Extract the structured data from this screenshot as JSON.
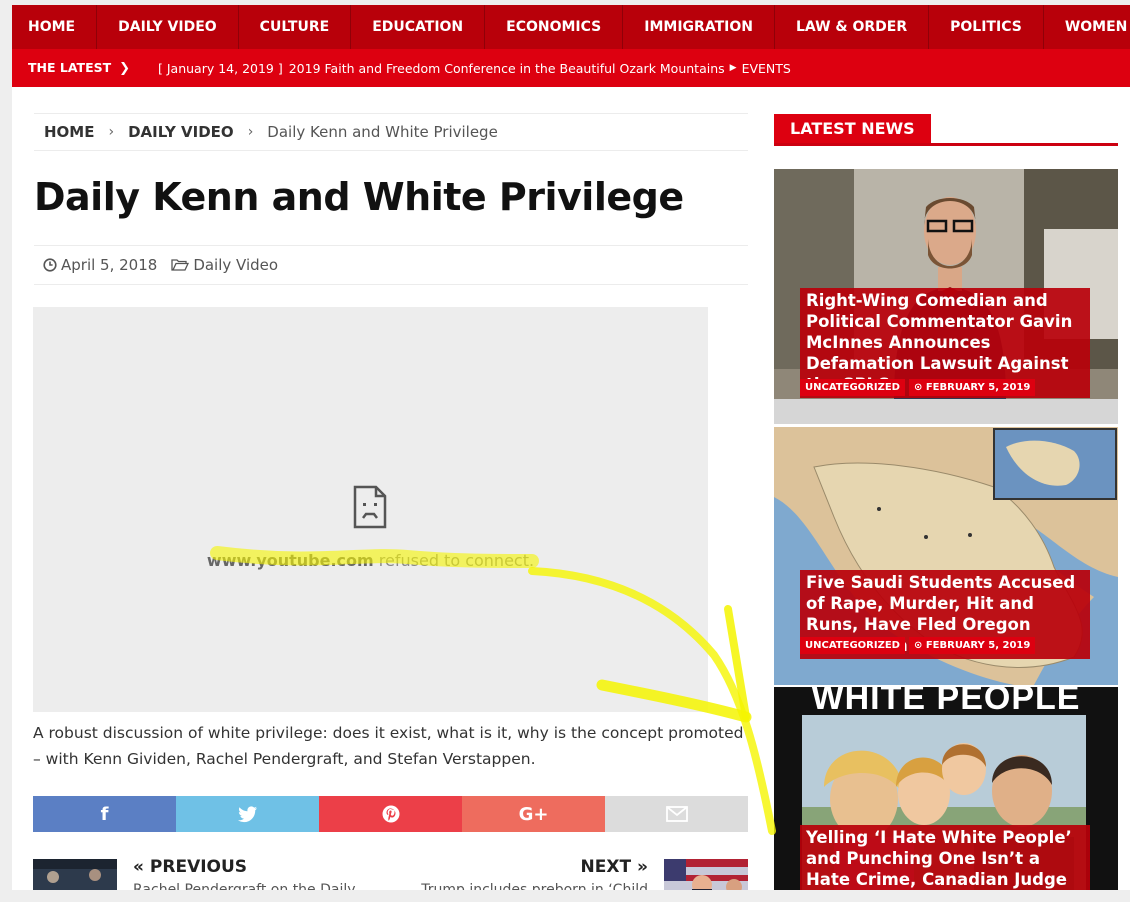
{
  "nav": {
    "items": [
      {
        "label": "HOME"
      },
      {
        "label": "DAILY VIDEO"
      },
      {
        "label": "CULTURE"
      },
      {
        "label": "EDUCATION"
      },
      {
        "label": "ECONOMICS"
      },
      {
        "label": "IMMIGRATION"
      },
      {
        "label": "LAW & ORDER"
      },
      {
        "label": "POLITICS"
      },
      {
        "label": "WOMEN"
      }
    ]
  },
  "ticker": {
    "label": "THE LATEST",
    "date": "[ January 14, 2019 ]",
    "headline": "2019 Faith and Freedom Conference in the Beautiful Ozark Mountains",
    "category": "EVENTS"
  },
  "breadcrumb": {
    "home": "HOME",
    "section": "DAILY VIDEO",
    "current": "Daily Kenn and White Privilege"
  },
  "article": {
    "title": "Daily Kenn and White Privilege",
    "date": "April 5, 2018",
    "category": "Daily Video",
    "embed_domain": "www.youtube.com",
    "embed_message": " refused to connect.",
    "description": "A robust discussion of white privilege: does it exist, what is it, why is the concept promoted – with Kenn Gividen, Rachel Pendergraft, and Stefan Verstappen."
  },
  "share": {
    "facebook": "f",
    "googleplus": "G+"
  },
  "postnav": {
    "prev_label": "« PREVIOUS",
    "prev_text": "Rachel Pendergraft on the Daily",
    "next_label": "NEXT »",
    "next_text": "Trump includes preborn in ‘Child"
  },
  "sidebar": {
    "heading": "LATEST NEWS",
    "cards": [
      {
        "title": "Right-Wing Comedian and Political Commentator Gavin McInnes Announces Defamation Lawsuit Against the SPLC",
        "category": "UNCATEGORIZED",
        "date": "⊙ FEBRUARY 5, 2019"
      },
      {
        "title": "Five Saudi Students Accused of Rape, Murder, Hit and Runs, Have Fled Oregon Before Trial",
        "category": "UNCATEGORIZED",
        "date": "⊙ FEBRUARY 5, 2019"
      },
      {
        "title": "Yelling ‘I Hate White People’ and Punching One Isn’t a Hate Crime, Canadian Judge Rules",
        "image_text": "WHITE PEOPLE"
      }
    ]
  },
  "colors": {
    "brand_red": "#b8000a",
    "ticker_red": "#dd0010",
    "highlight": "#f5f500"
  }
}
